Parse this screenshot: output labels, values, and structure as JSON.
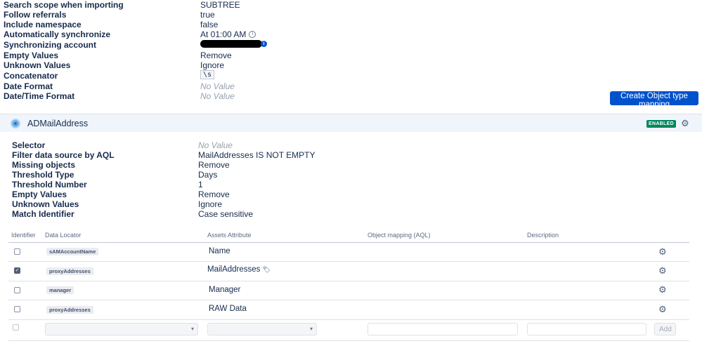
{
  "import_settings": {
    "rows": [
      {
        "label": "Search scope when importing",
        "value": "SUBTREE"
      },
      {
        "label": "Follow referrals",
        "value": "true"
      },
      {
        "label": "Include namespace",
        "value": "false"
      },
      {
        "label": "Automatically synchronize",
        "value": "At 01:00 AM"
      },
      {
        "label": "Synchronizing account",
        "value": ""
      },
      {
        "label": "Empty Values",
        "value": "Remove"
      },
      {
        "label": "Unknown Values",
        "value": "Ignore"
      },
      {
        "label": "Concatenator",
        "value": "\\s"
      },
      {
        "label": "Date Format",
        "value": "No Value"
      },
      {
        "label": "Date/Time Format",
        "value": "No Value"
      }
    ]
  },
  "create_mapping_button": "Create Object type mapping",
  "object_mapping": {
    "name": "ADMailAddress",
    "status": "ENABLED",
    "rows": [
      {
        "label": "Selector",
        "value": "No Value"
      },
      {
        "label": "Filter data source by AQL",
        "value": "MailAddresses IS NOT EMPTY"
      },
      {
        "label": "Missing objects",
        "value": "Remove"
      },
      {
        "label": "Threshold Type",
        "value": "Days"
      },
      {
        "label": "Threshold Number",
        "value": "1"
      },
      {
        "label": "Empty Values",
        "value": "Remove"
      },
      {
        "label": "Unknown Values",
        "value": "Ignore"
      },
      {
        "label": "Match Identifier",
        "value": "Case sensitive"
      }
    ]
  },
  "table": {
    "headers": [
      "Identifier",
      "Data Locator",
      "Assets Attribute",
      "Object mapping (AQL)",
      "Description"
    ],
    "rows": [
      {
        "identifier": false,
        "locator": "sAMAccountName",
        "attribute": "Name"
      },
      {
        "identifier": true,
        "locator": "proxyAddresses",
        "attribute": "MailAddresses",
        "attribute_icon": "tag-icon"
      },
      {
        "identifier": false,
        "locator": "manager",
        "attribute": "Manager"
      },
      {
        "identifier": false,
        "locator": "proxyAddresses",
        "attribute": "RAW Data"
      }
    ],
    "add_button": "Add"
  },
  "colors": {
    "primary": "#0052cc",
    "enabled_badge": "#00875a",
    "header_band": "#f0f5fc"
  }
}
